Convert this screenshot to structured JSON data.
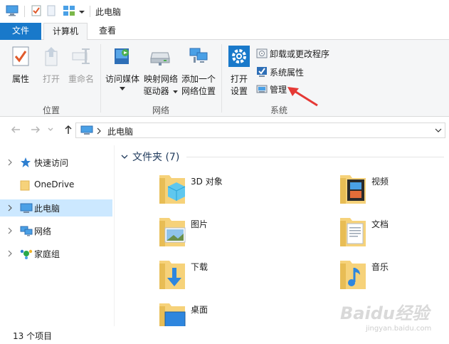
{
  "window": {
    "title": "此电脑"
  },
  "tabs": {
    "file": "文件",
    "computer": "计算机",
    "view": "查看"
  },
  "ribbon": {
    "location": {
      "label": "位置",
      "properties": "属性",
      "open": "打开",
      "rename": "重命名"
    },
    "network": {
      "label": "网络",
      "media_line1": "访问媒体",
      "map_line1": "映射网络",
      "map_line2": "驱动器",
      "add_line1": "添加一个",
      "add_line2": "网络位置"
    },
    "system": {
      "label": "系统",
      "settings_line1": "打开",
      "settings_line2": "设置",
      "uninstall": "卸载或更改程序",
      "sys_props": "系统属性",
      "manage": "管理"
    }
  },
  "address": {
    "path": "此电脑"
  },
  "sidebar": {
    "items": [
      {
        "label": "快速访问",
        "icon": "star-icon"
      },
      {
        "label": "OneDrive",
        "icon": "onedrive-folder-icon"
      },
      {
        "label": "此电脑",
        "icon": "computer-icon"
      },
      {
        "label": "网络",
        "icon": "network-icon"
      },
      {
        "label": "家庭组",
        "icon": "homegroup-icon"
      }
    ]
  },
  "main": {
    "section_title": "文件夹 (7)",
    "folders": [
      {
        "label": "3D 对象",
        "icon": "3d-objects-folder-icon"
      },
      {
        "label": "视频",
        "icon": "videos-folder-icon"
      },
      {
        "label": "图片",
        "icon": "pictures-folder-icon"
      },
      {
        "label": "文档",
        "icon": "documents-folder-icon"
      },
      {
        "label": "下载",
        "icon": "downloads-folder-icon"
      },
      {
        "label": "音乐",
        "icon": "music-folder-icon"
      },
      {
        "label": "桌面",
        "icon": "desktop-folder-icon"
      }
    ]
  },
  "status": {
    "item_count": "13 个项目"
  },
  "watermark": {
    "text": "Baidu经验",
    "url": "jingyan.baidu.com"
  },
  "colors": {
    "accent": "#1979ca",
    "selected": "#cce8ff",
    "annotation_arrow": "#e53935"
  }
}
